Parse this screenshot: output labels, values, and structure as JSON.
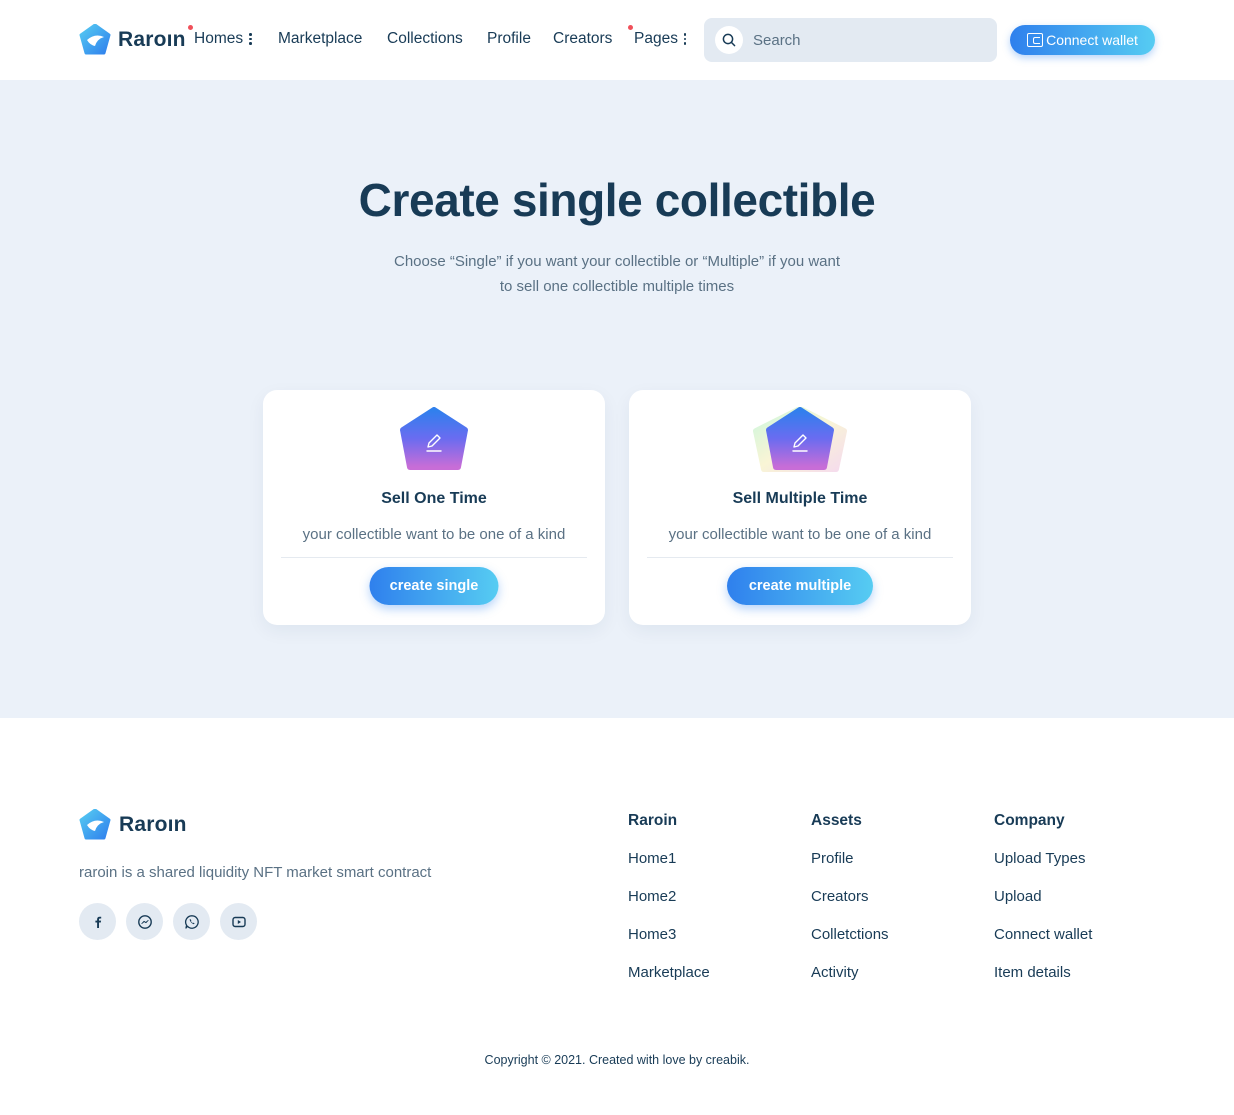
{
  "header": {
    "brand": "Raroın",
    "nav": [
      {
        "label": "Homes",
        "has_menu": true,
        "dot": true
      },
      {
        "label": "Marketplace",
        "has_menu": false,
        "dot": false
      },
      {
        "label": "Collections",
        "has_menu": false,
        "dot": false
      },
      {
        "label": "Profile",
        "has_menu": false,
        "dot": false
      },
      {
        "label": "Creators",
        "has_menu": false,
        "dot": false
      },
      {
        "label": "Pages",
        "has_menu": true,
        "dot": true
      }
    ],
    "search_placeholder": "Search",
    "wallet_label": "Connect wallet",
    "dot_color": "#f0505a"
  },
  "main": {
    "title": "Create single collectible",
    "subtitle": "Choose “Single” if you want your collectible or “Multiple” if you want to sell one collectible multiple times",
    "cards": [
      {
        "title": "Sell One Time",
        "description": "your collectible want to be one of a kind",
        "button": "create single",
        "icon": "edit-pen-icon"
      },
      {
        "title": "Sell Multiple Time",
        "description": "your collectible want to be one of a kind",
        "button": "create multiple",
        "icon": "edit-pen-layered-icon"
      }
    ]
  },
  "footer": {
    "brand": "Raroın",
    "description": "raroin is a shared liquidity NFT market smart contract",
    "socials": [
      "facebook-icon",
      "messenger-icon",
      "whatsapp-icon",
      "youtube-icon"
    ],
    "columns": [
      {
        "title": "Raroin",
        "links": [
          "Home1",
          "Home2",
          "Home3",
          "Marketplace"
        ]
      },
      {
        "title": "Assets",
        "links": [
          "Profile",
          "Creators",
          "Colletctions",
          "Activity"
        ]
      },
      {
        "title": "Company",
        "links": [
          "Upload Types",
          "Upload",
          "Connect wallet",
          "Item details"
        ]
      }
    ],
    "copyright": "Copyright © 2021. Created with love by creabik."
  },
  "colors": {
    "text": "#183b56",
    "muted": "#5a7184",
    "accent_start": "#2f80ed",
    "accent_end": "#56ccf2",
    "section_bg": "#ebf1f9"
  }
}
